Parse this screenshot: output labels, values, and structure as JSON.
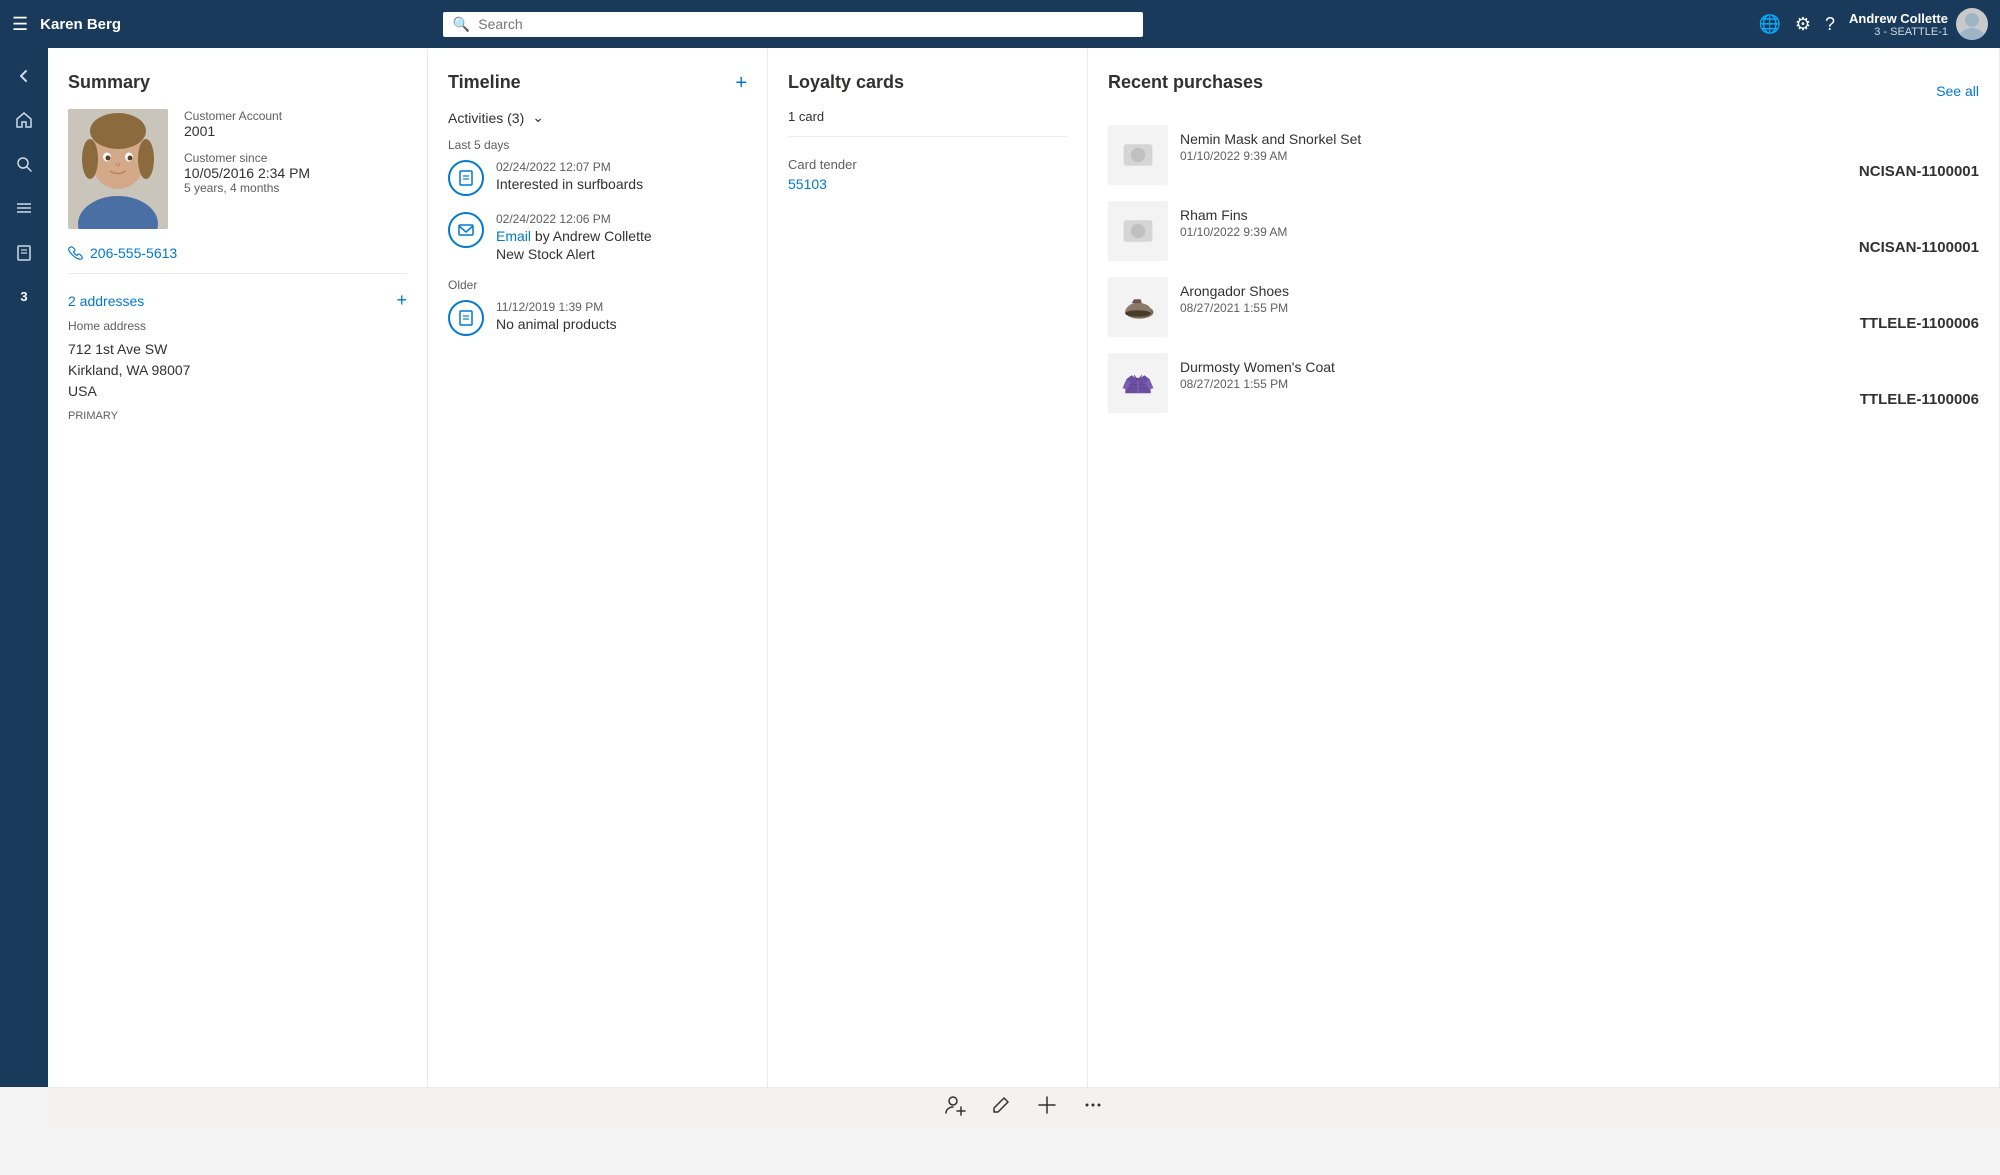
{
  "topnav": {
    "hamburger_icon": "☰",
    "app_title": "Karen Berg",
    "search_placeholder": "Search",
    "globe_icon": "🌐",
    "settings_icon": "⚙",
    "help_icon": "?",
    "user": {
      "name": "Andrew Collette",
      "sub": "3 - SEATTLE-1"
    }
  },
  "sidebar": {
    "items": [
      {
        "label": "back",
        "icon": "←"
      },
      {
        "label": "home",
        "icon": "⌂"
      },
      {
        "label": "search",
        "icon": "🔍"
      },
      {
        "label": "menu",
        "icon": "☰"
      },
      {
        "label": "clipboard",
        "icon": "📋"
      },
      {
        "label": "badge",
        "text": "3"
      }
    ]
  },
  "summary": {
    "title": "Summary",
    "customer_account_label": "Customer Account",
    "customer_account_value": "2001",
    "customer_since_label": "Customer since",
    "customer_since_date": "10/05/2016 2:34 PM",
    "customer_since_duration": "5 years, 4 months",
    "phone": "206-555-5613",
    "addresses_link": "2 addresses",
    "home_address_label": "Home address",
    "address_line1": "712 1st Ave SW",
    "address_line2": "Kirkland, WA 98007",
    "address_line3": "USA",
    "primary_badge": "PRIMARY"
  },
  "timeline": {
    "title": "Timeline",
    "activities_label": "Activities (3)",
    "last5days_label": "Last 5 days",
    "older_label": "Older",
    "add_icon": "+",
    "items": [
      {
        "date": "02/24/2022 12:07 PM",
        "description": "Interested in surfboards",
        "type": "note"
      },
      {
        "date": "02/24/2022 12:06 PM",
        "email_label": "Email",
        "by": "by Andrew Collette",
        "description": "New Stock Alert",
        "type": "email"
      }
    ],
    "older_items": [
      {
        "date": "11/12/2019 1:39 PM",
        "description": "No animal products",
        "type": "note"
      }
    ]
  },
  "loyalty": {
    "title": "Loyalty cards",
    "count": "1 card",
    "card_tender_label": "Card tender",
    "card_id": "55103"
  },
  "purchases": {
    "title": "Recent purchases",
    "see_all": "See all",
    "items": [
      {
        "name": "Nemin Mask and Snorkel Set",
        "date": "01/10/2022 9:39 AM",
        "order_id": "NCISAN-1100001",
        "type": "generic"
      },
      {
        "name": "Rham Fins",
        "date": "01/10/2022 9:39 AM",
        "order_id": "NCISAN-1100001",
        "type": "generic"
      },
      {
        "name": "Arongador Shoes",
        "date": "08/27/2021 1:55 PM",
        "order_id": "TTLELE-1100006",
        "type": "shoe"
      },
      {
        "name": "Durmosty Women's Coat",
        "date": "08/27/2021 1:55 PM",
        "order_id": "TTLELE-1100006",
        "type": "jacket"
      }
    ]
  },
  "bottombar": {
    "person_icon": "👤",
    "edit_icon": "✏",
    "add_icon": "+",
    "more_icon": "···"
  }
}
